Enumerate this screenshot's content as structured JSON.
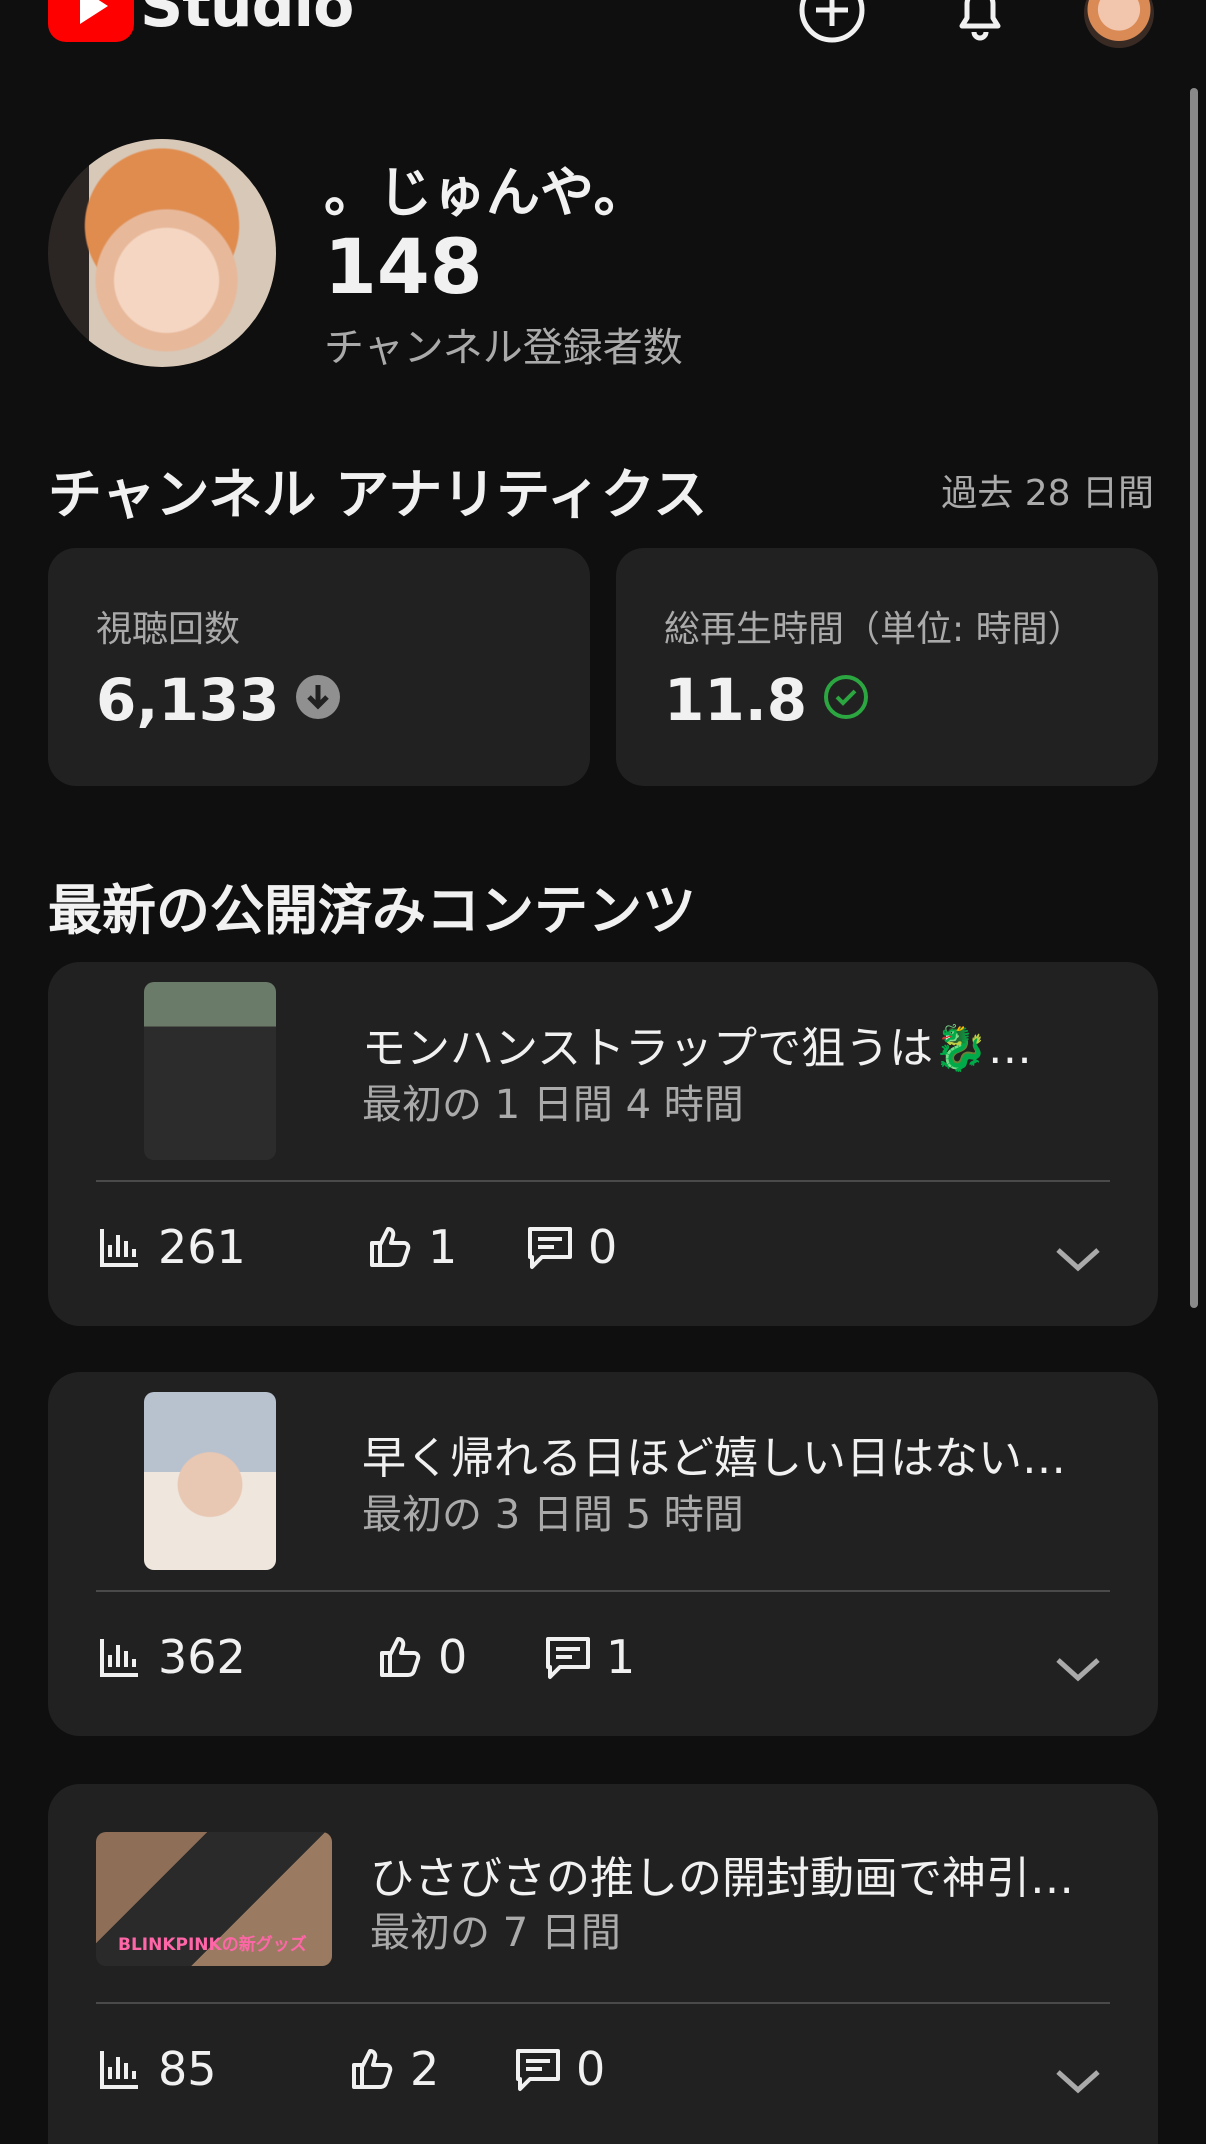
{
  "header": {
    "app_name": "Studio",
    "icons": [
      "youtube-logo-icon",
      "create-plus-icon",
      "bell-icon",
      "account-avatar"
    ]
  },
  "channel": {
    "name": "。じゅんや。",
    "subscribers": "148",
    "subscribers_label": "チャンネル登録者数"
  },
  "analytics": {
    "title": "チャンネル アナリティクス",
    "period": "過去 28 日間",
    "cards": [
      {
        "label": "視聴回数",
        "value": "6,133",
        "status_icon": "down-arrow-circle-icon"
      },
      {
        "label": "総再生時間（単位: 時間）",
        "value": "11.8",
        "status_icon": "check-circle-icon",
        "status_color": "#2ba640"
      }
    ]
  },
  "latest": {
    "title": "最新の公開済みコンテンツ",
    "videos": [
      {
        "title": "モンハンストラップで狙うは🐉…",
        "subtitle": "最初の 1 日間 4 時間",
        "views": "261",
        "likes": "1",
        "comments": "0"
      },
      {
        "title": "早く帰れる日ほど嬉しい日はない…",
        "subtitle": "最初の 3 日間 5 時間",
        "views": "362",
        "likes": "0",
        "comments": "1"
      },
      {
        "title": "ひさびさの推しの開封動画で神引…",
        "subtitle": "最初の 7 日間",
        "views": "85",
        "likes": "2",
        "comments": "0",
        "thumb_caption": "BLINKPINKの新グッズ"
      }
    ]
  },
  "colors": {
    "background": "#0f0f0f",
    "card": "#212121",
    "brand_red": "#ff0000",
    "secondary_text": "#aaaaaa"
  }
}
